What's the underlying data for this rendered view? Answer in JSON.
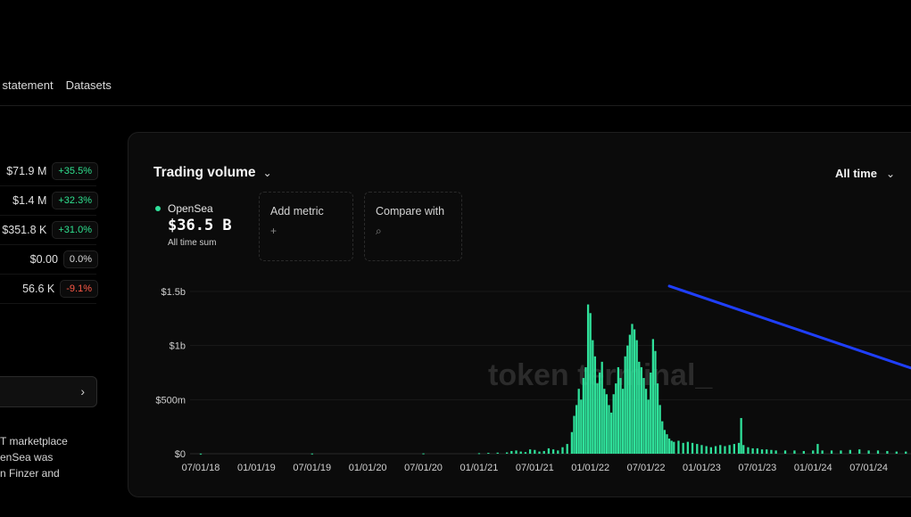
{
  "tabs": [
    "l statement",
    "Datasets"
  ],
  "metrics": [
    {
      "value": "$71.9 M",
      "change": "+35.5%",
      "trend": "pos"
    },
    {
      "value": "$1.4 M",
      "change": "+32.3%",
      "trend": "pos"
    },
    {
      "value": "$351.8 K",
      "change": "+31.0%",
      "trend": "pos"
    },
    {
      "value": "$0.00",
      "change": "0.0%",
      "trend": "neu"
    },
    {
      "value": "56.6 K",
      "change": "-9.1%",
      "trend": "neg"
    }
  ],
  "description_lines": [
    "T marketplace",
    "enSea was",
    "n Finzer and"
  ],
  "card": {
    "title": "Trading volume",
    "timeframe": "All time",
    "legend": {
      "name": "OpenSea",
      "value": "$36.5 B",
      "subtitle": "All time sum"
    },
    "add_metric": "Add metric",
    "compare_with": "Compare with",
    "watermark": "token terminal_"
  },
  "colors": {
    "series": "#2fe09a",
    "annotation_line": "#1f3fff",
    "positive": "#2fe08f",
    "negative": "#ff5a47"
  },
  "icons": {
    "add": "plus-icon",
    "search": "search-icon",
    "chevron": "chevron-down-icon"
  },
  "chart_data": {
    "type": "bar",
    "title": "Trading volume",
    "series_name": "OpenSea",
    "y_ticks": [
      "$0",
      "$500m",
      "$1b",
      "$1.5b"
    ],
    "ylim": [
      0,
      1.5
    ],
    "y_unit": "billions USD",
    "x_ticks": [
      "07/01/18",
      "01/01/19",
      "07/01/19",
      "01/01/20",
      "07/01/20",
      "01/01/21",
      "07/01/21",
      "01/01/22",
      "07/01/22",
      "01/01/23",
      "07/01/23",
      "01/01/24",
      "07/01/24"
    ],
    "x_range_months": [
      0,
      78
    ],
    "bars": [
      [
        0.0,
        0.001
      ],
      [
        12.0,
        0.002
      ],
      [
        24.0,
        0.003
      ],
      [
        30.0,
        0.005
      ],
      [
        31.0,
        0.008
      ],
      [
        32.0,
        0.01
      ],
      [
        33.0,
        0.012
      ],
      [
        33.5,
        0.025
      ],
      [
        34.0,
        0.03
      ],
      [
        34.5,
        0.02
      ],
      [
        35.0,
        0.015
      ],
      [
        35.5,
        0.04
      ],
      [
        36.0,
        0.035
      ],
      [
        36.5,
        0.02
      ],
      [
        37.0,
        0.025
      ],
      [
        37.5,
        0.05
      ],
      [
        38.0,
        0.04
      ],
      [
        38.5,
        0.03
      ],
      [
        39.0,
        0.06
      ],
      [
        39.5,
        0.09
      ],
      [
        40.0,
        0.2
      ],
      [
        40.25,
        0.35
      ],
      [
        40.5,
        0.45
      ],
      [
        40.75,
        0.6
      ],
      [
        41.0,
        0.5
      ],
      [
        41.25,
        0.7
      ],
      [
        41.5,
        0.8
      ],
      [
        41.75,
        1.38
      ],
      [
        42.0,
        1.3
      ],
      [
        42.25,
        1.05
      ],
      [
        42.5,
        0.9
      ],
      [
        42.75,
        0.65
      ],
      [
        43.0,
        0.75
      ],
      [
        43.25,
        0.85
      ],
      [
        43.5,
        0.6
      ],
      [
        43.75,
        0.55
      ],
      [
        44.0,
        0.45
      ],
      [
        44.25,
        0.38
      ],
      [
        44.5,
        0.55
      ],
      [
        44.75,
        0.65
      ],
      [
        45.0,
        0.8
      ],
      [
        45.25,
        0.7
      ],
      [
        45.5,
        0.6
      ],
      [
        45.75,
        0.9
      ],
      [
        46.0,
        1.0
      ],
      [
        46.25,
        1.1
      ],
      [
        46.5,
        1.2
      ],
      [
        46.75,
        1.15
      ],
      [
        47.0,
        1.05
      ],
      [
        47.25,
        0.85
      ],
      [
        47.5,
        0.8
      ],
      [
        47.75,
        0.7
      ],
      [
        48.0,
        0.6
      ],
      [
        48.25,
        0.5
      ],
      [
        48.5,
        0.75
      ],
      [
        48.75,
        1.06
      ],
      [
        49.0,
        0.95
      ],
      [
        49.25,
        0.65
      ],
      [
        49.5,
        0.45
      ],
      [
        49.75,
        0.3
      ],
      [
        50.0,
        0.22
      ],
      [
        50.25,
        0.18
      ],
      [
        50.5,
        0.14
      ],
      [
        50.75,
        0.12
      ],
      [
        51.0,
        0.11
      ],
      [
        51.5,
        0.12
      ],
      [
        52.0,
        0.1
      ],
      [
        52.5,
        0.11
      ],
      [
        53.0,
        0.1
      ],
      [
        53.5,
        0.09
      ],
      [
        54.0,
        0.08
      ],
      [
        54.5,
        0.07
      ],
      [
        55.0,
        0.06
      ],
      [
        55.5,
        0.07
      ],
      [
        56.0,
        0.08
      ],
      [
        56.5,
        0.07
      ],
      [
        57.0,
        0.08
      ],
      [
        57.5,
        0.09
      ],
      [
        58.0,
        0.1
      ],
      [
        58.25,
        0.33
      ],
      [
        58.5,
        0.08
      ],
      [
        59.0,
        0.06
      ],
      [
        59.5,
        0.05
      ],
      [
        60.0,
        0.05
      ],
      [
        60.5,
        0.04
      ],
      [
        61.0,
        0.04
      ],
      [
        61.5,
        0.035
      ],
      [
        62.0,
        0.03
      ],
      [
        63.0,
        0.03
      ],
      [
        64.0,
        0.03
      ],
      [
        65.0,
        0.025
      ],
      [
        66.0,
        0.03
      ],
      [
        66.5,
        0.09
      ],
      [
        67.0,
        0.03
      ],
      [
        68.0,
        0.03
      ],
      [
        69.0,
        0.03
      ],
      [
        70.0,
        0.035
      ],
      [
        71.0,
        0.04
      ],
      [
        72.0,
        0.03
      ],
      [
        73.0,
        0.03
      ],
      [
        74.0,
        0.025
      ],
      [
        75.0,
        0.02
      ],
      [
        76.0,
        0.02
      ],
      [
        77.0,
        0.02
      ]
    ],
    "annotation_line": {
      "from": [
        50.5,
        1.55
      ],
      "to": [
        78.0,
        0.75
      ]
    }
  }
}
